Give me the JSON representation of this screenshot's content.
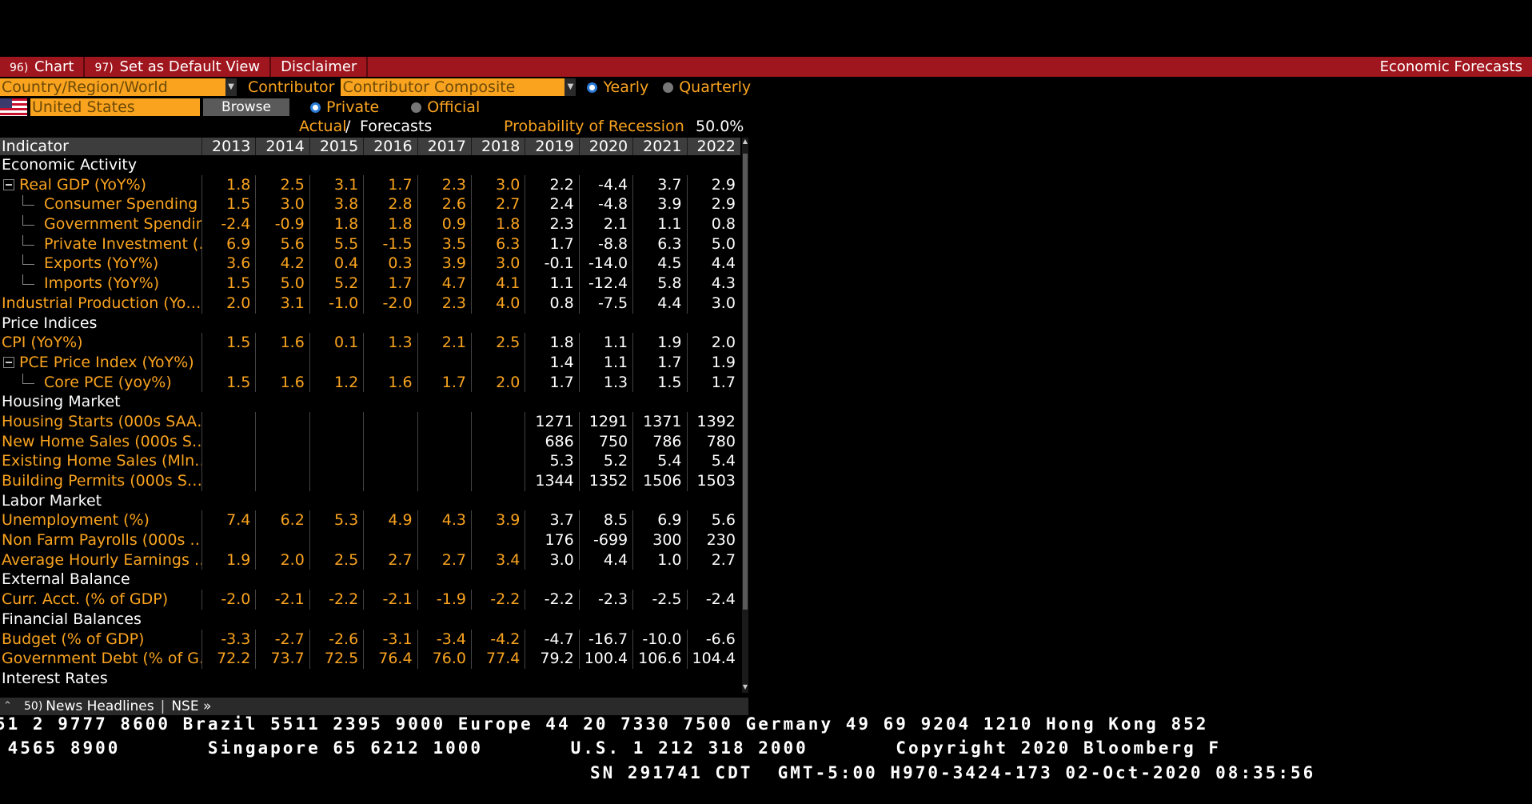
{
  "topbar": {
    "chart_num": "96)",
    "chart_label": "Chart",
    "default_num": "97)",
    "default_label": "Set as Default View",
    "disclaimer_label": "Disclaimer",
    "title": "Economic Forecasts"
  },
  "controls": {
    "region_type": "Country/Region/World",
    "contributor_label": "Contributor",
    "contributor_value": "Contributor Composite",
    "yearly_label": "Yearly",
    "quarterly_label": "Quarterly",
    "country_value": "United States",
    "browse_label": "Browse",
    "private_label": "Private",
    "official_label": "Official"
  },
  "header_info": {
    "actual_label": "Actual",
    "forecasts_label": "Forecasts",
    "recession_label": "Probability of Recession",
    "recession_value": "50.0%"
  },
  "table": {
    "indicator_header": "Indicator",
    "years": [
      "2013",
      "2014",
      "2015",
      "2016",
      "2017",
      "2018",
      "2019",
      "2020",
      "2021",
      "2022"
    ],
    "rows": [
      {
        "type": "section",
        "label": "Economic Activity"
      },
      {
        "type": "parent",
        "label": "Real GDP (YoY%)",
        "values": [
          "1.8",
          "2.5",
          "3.1",
          "1.7",
          "2.3",
          "3.0",
          "2.2",
          "-4.4",
          "3.7",
          "2.9"
        ]
      },
      {
        "type": "child",
        "label": "Consumer Spending …",
        "values": [
          "1.5",
          "3.0",
          "3.8",
          "2.8",
          "2.6",
          "2.7",
          "2.4",
          "-4.8",
          "3.9",
          "2.9"
        ]
      },
      {
        "type": "child",
        "label": "Government Spendin…",
        "values": [
          "-2.4",
          "-0.9",
          "1.8",
          "1.8",
          "0.9",
          "1.8",
          "2.3",
          "2.1",
          "1.1",
          "0.8"
        ]
      },
      {
        "type": "child",
        "label": "Private Investment (…",
        "values": [
          "6.9",
          "5.6",
          "5.5",
          "-1.5",
          "3.5",
          "6.3",
          "1.7",
          "-8.8",
          "6.3",
          "5.0"
        ]
      },
      {
        "type": "child",
        "label": "Exports (YoY%)",
        "values": [
          "3.6",
          "4.2",
          "0.4",
          "0.3",
          "3.9",
          "3.0",
          "-0.1",
          "-14.0",
          "4.5",
          "4.4"
        ]
      },
      {
        "type": "child",
        "label": "Imports (YoY%)",
        "values": [
          "1.5",
          "5.0",
          "5.2",
          "1.7",
          "4.7",
          "4.1",
          "1.1",
          "-12.4",
          "5.8",
          "4.3"
        ]
      },
      {
        "type": "plain",
        "label": "Industrial Production (Yo…",
        "values": [
          "2.0",
          "3.1",
          "-1.0",
          "-2.0",
          "2.3",
          "4.0",
          "0.8",
          "-7.5",
          "4.4",
          "3.0"
        ]
      },
      {
        "type": "section",
        "label": "Price Indices"
      },
      {
        "type": "plain",
        "label": "CPI (YoY%)",
        "values": [
          "1.5",
          "1.6",
          "0.1",
          "1.3",
          "2.1",
          "2.5",
          "1.8",
          "1.1",
          "1.9",
          "2.0"
        ]
      },
      {
        "type": "parent",
        "label": "PCE Price Index (YoY%)",
        "values": [
          "",
          "",
          "",
          "",
          "",
          "",
          "1.4",
          "1.1",
          "1.7",
          "1.9"
        ]
      },
      {
        "type": "child",
        "label": "Core PCE (yoy%)",
        "values": [
          "1.5",
          "1.6",
          "1.2",
          "1.6",
          "1.7",
          "2.0",
          "1.7",
          "1.3",
          "1.5",
          "1.7"
        ]
      },
      {
        "type": "section",
        "label": "Housing Market"
      },
      {
        "type": "plain",
        "label": "Housing Starts (000s SAA…",
        "values": [
          "",
          "",
          "",
          "",
          "",
          "",
          "1271",
          "1291",
          "1371",
          "1392"
        ]
      },
      {
        "type": "plain",
        "label": "New Home Sales (000s S…",
        "values": [
          "",
          "",
          "",
          "",
          "",
          "",
          "686",
          "750",
          "786",
          "780"
        ]
      },
      {
        "type": "plain",
        "label": "Existing Home Sales (Mln…",
        "values": [
          "",
          "",
          "",
          "",
          "",
          "",
          "5.3",
          "5.2",
          "5.4",
          "5.4"
        ]
      },
      {
        "type": "plain",
        "label": "Building Permits (000s S…",
        "values": [
          "",
          "",
          "",
          "",
          "",
          "",
          "1344",
          "1352",
          "1506",
          "1503"
        ]
      },
      {
        "type": "section",
        "label": "Labor Market"
      },
      {
        "type": "plain",
        "label": "Unemployment (%)",
        "values": [
          "7.4",
          "6.2",
          "5.3",
          "4.9",
          "4.3",
          "3.9",
          "3.7",
          "8.5",
          "6.9",
          "5.6"
        ]
      },
      {
        "type": "plain",
        "label": "Non Farm Payrolls (000s …",
        "values": [
          "",
          "",
          "",
          "",
          "",
          "",
          "176",
          "-699",
          "300",
          "230"
        ]
      },
      {
        "type": "plain",
        "label": "Average Hourly Earnings …",
        "values": [
          "1.9",
          "2.0",
          "2.5",
          "2.7",
          "2.7",
          "3.4",
          "3.0",
          "4.4",
          "1.0",
          "2.7"
        ]
      },
      {
        "type": "section",
        "label": "External Balance"
      },
      {
        "type": "plain",
        "label": "Curr. Acct. (% of GDP)",
        "values": [
          "-2.0",
          "-2.1",
          "-2.2",
          "-2.1",
          "-1.9",
          "-2.2",
          "-2.2",
          "-2.3",
          "-2.5",
          "-2.4"
        ]
      },
      {
        "type": "section",
        "label": "Financial Balances"
      },
      {
        "type": "plain",
        "label": "Budget (% of GDP)",
        "values": [
          "-3.3",
          "-2.7",
          "-2.6",
          "-3.1",
          "-3.4",
          "-4.2",
          "-4.7",
          "-16.7",
          "-10.0",
          "-6.6"
        ]
      },
      {
        "type": "plain",
        "label": "Government Debt (% of G…",
        "values": [
          "72.2",
          "73.7",
          "72.5",
          "76.4",
          "76.0",
          "77.4",
          "79.2",
          "100.4",
          "106.6",
          "104.4"
        ]
      },
      {
        "type": "section",
        "label": "Interest Rates"
      }
    ]
  },
  "newsbar": {
    "num": "50)",
    "label": "News Headlines",
    "source": "NSE »"
  },
  "footer": {
    "line1": "51 2 9777 8600 Brazil 5511 2395 9000 Europe 44 20 7330 7500 Germany 49 69 9204 1210 Hong Kong 852",
    "line2": " 4565 8900       Singapore 65 6212 1000       U.S. 1 212 318 2000       Copyright 2020 Bloomberg F",
    "line3": "SN 291741 CDT  GMT-5:00 H970-3424-173 02-Oct-2020 08:35:56"
  },
  "colors": {
    "amber": "#f9a31f",
    "topbar_red": "#a0161e",
    "background": "#000000"
  }
}
